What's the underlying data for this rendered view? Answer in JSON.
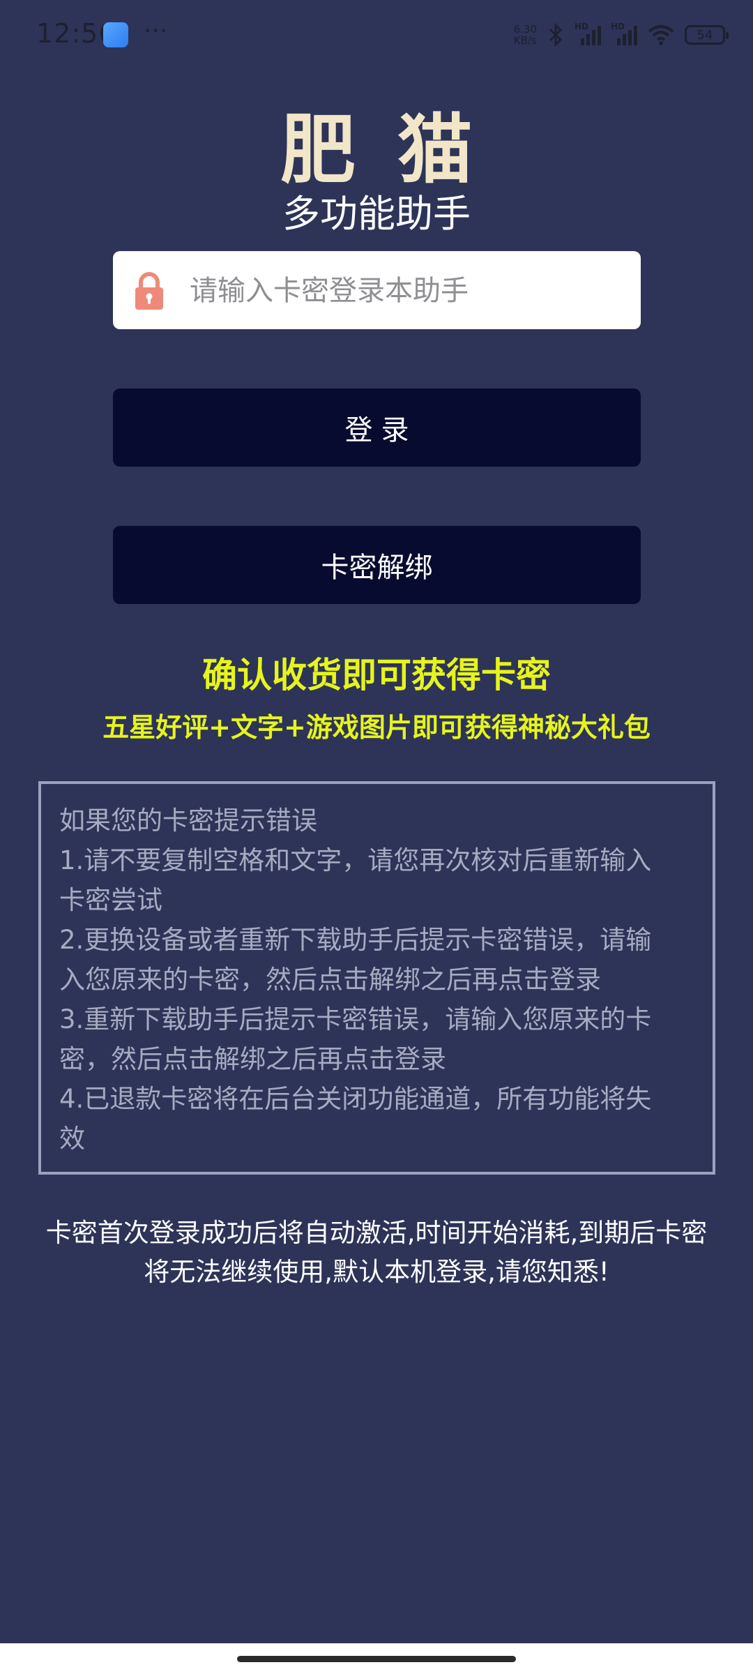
{
  "status_bar": {
    "time": "12:56",
    "dots": "···",
    "net_speed_value": "6.30",
    "net_speed_unit": "KB/s",
    "hd1": "HD",
    "hd2": "HD",
    "battery": "54"
  },
  "header": {
    "title": "肥猫",
    "subtitle": "多功能助手"
  },
  "login_form": {
    "card_key_placeholder": "请输入卡密登录本助手",
    "card_key_value": "",
    "login_button_label": "登录",
    "unbind_button_label": "卡密解绑"
  },
  "promo": {
    "main": "确认收货即可获得卡密",
    "sub": "五星好评+文字+游戏图片即可获得神秘大礼包"
  },
  "help": {
    "lines": [
      "如果您的卡密提示错误",
      "1.请不要复制空格和文字，请您再次核对后重新输入",
      "卡密尝试",
      "2.更换设备或者重新下载助手后提示卡密错误，请输",
      "入您原来的卡密，然后点击解绑之后再点击登录",
      "3.重新下载助手后提示卡密错误，请输入您原来的卡",
      "密，然后点击解绑之后再点击登录",
      "4.已退款卡密将在后台关闭功能通道，所有功能将失",
      "效"
    ]
  },
  "notice": {
    "line1": "卡密首次登录成功后将自动激活,时间开始消耗,到期后卡密",
    "line2": "将无法继续使用,默认本机登录,请您知悉!"
  },
  "colors": {
    "background": "#2d3458",
    "title": "#f1e6c8",
    "button": "#070b2f",
    "promo": "#e6f51a",
    "lock_icon": "#ef8a7a"
  }
}
